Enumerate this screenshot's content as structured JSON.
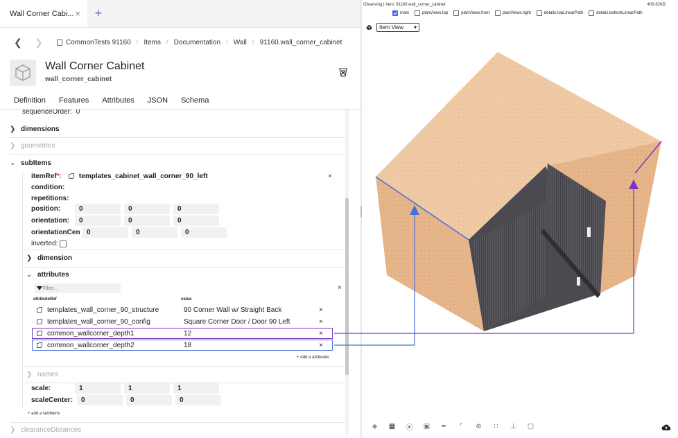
{
  "tab": {
    "title": "Wall Corner Cabi...",
    "close": "×",
    "new": "+"
  },
  "breadcrumb": [
    "CommonTests 91160",
    "Items",
    "Documentation",
    "Wall",
    "91160.wall_corner_cabinet"
  ],
  "header": {
    "title": "Wall Corner Cabinet",
    "subtitle": "wall_corner_cabinet"
  },
  "navtabs": [
    "Definition",
    "Features",
    "Attributes",
    "JSON",
    "Schema"
  ],
  "sequence": {
    "label": "sequenceOrder:",
    "value": "0"
  },
  "sections": {
    "dimensions": "dimensions",
    "geometries": "geometries",
    "subitems": "subItems",
    "clearance": "clearanceDistances"
  },
  "subitem": {
    "itemref_label": "itemRef",
    "itemref_required": "*:",
    "itemref_value": "templates_cabinet_wall_corner_90_left",
    "condition": "condition:",
    "repetitions": "repetitions:",
    "position": {
      "label": "position:",
      "values": [
        "0",
        "0",
        "0"
      ]
    },
    "orientation": {
      "label": "orientation:",
      "values": [
        "0",
        "0",
        "0"
      ]
    },
    "orientationCenter": {
      "label": "orientationCen",
      "values": [
        "0",
        "0",
        "0"
      ]
    },
    "inverted": "inverted:",
    "dimension": "dimension",
    "attributes": "attributes",
    "filter_placeholder": "Filter...",
    "col_ref": "attributeRef",
    "col_value": "value",
    "attribute_rows": [
      {
        "ref": "templates_wall_corner_90_structure",
        "value": "90 Corner Wall w/ Straight Back"
      },
      {
        "ref": "templates_wall_corner_90_config",
        "value": "Square Corner Door / Door 90 Left"
      },
      {
        "ref": "common_wallcorner_depth1",
        "value": "12"
      },
      {
        "ref": "common_wallcorner_depth2",
        "value": "18"
      }
    ],
    "add_attribute": "+ Add a attributes",
    "names": "names",
    "scale": {
      "label": "scale:",
      "values": [
        "1",
        "1",
        "1"
      ]
    },
    "scaleCenter": {
      "label": "scaleCenter:",
      "values": [
        "0",
        "0",
        "0"
      ]
    },
    "add_subitem": "+ add a subItems"
  },
  "viewer": {
    "observing": "Observing | Item: 91160.wall_corner_cabinet",
    "filesize": "409.82KB",
    "checkboxes": [
      {
        "label": "main",
        "checked": true
      },
      {
        "label": "planViews.top",
        "checked": false
      },
      {
        "label": "planViews.front",
        "checked": false
      },
      {
        "label": "planViews.right",
        "checked": false
      },
      {
        "label": "details.topLinearPath",
        "checked": false
      },
      {
        "label": "details.bottomLinearPath",
        "checked": false
      }
    ],
    "view_mode": "Item View",
    "toolbar_icons": [
      "palette-icon",
      "grid-icon",
      "compass-icon",
      "cube-icon",
      "brush-icon",
      "crop-icon",
      "target-icon",
      "dots-grid-icon",
      "measure-icon",
      "image-icon"
    ],
    "colors": {
      "accent_blue": "#4a6ed8",
      "accent_purple": "#7b34c9",
      "wood_light": "#e9b98c",
      "door_dark": "#4d4d53"
    }
  },
  "close_glyph": "×"
}
